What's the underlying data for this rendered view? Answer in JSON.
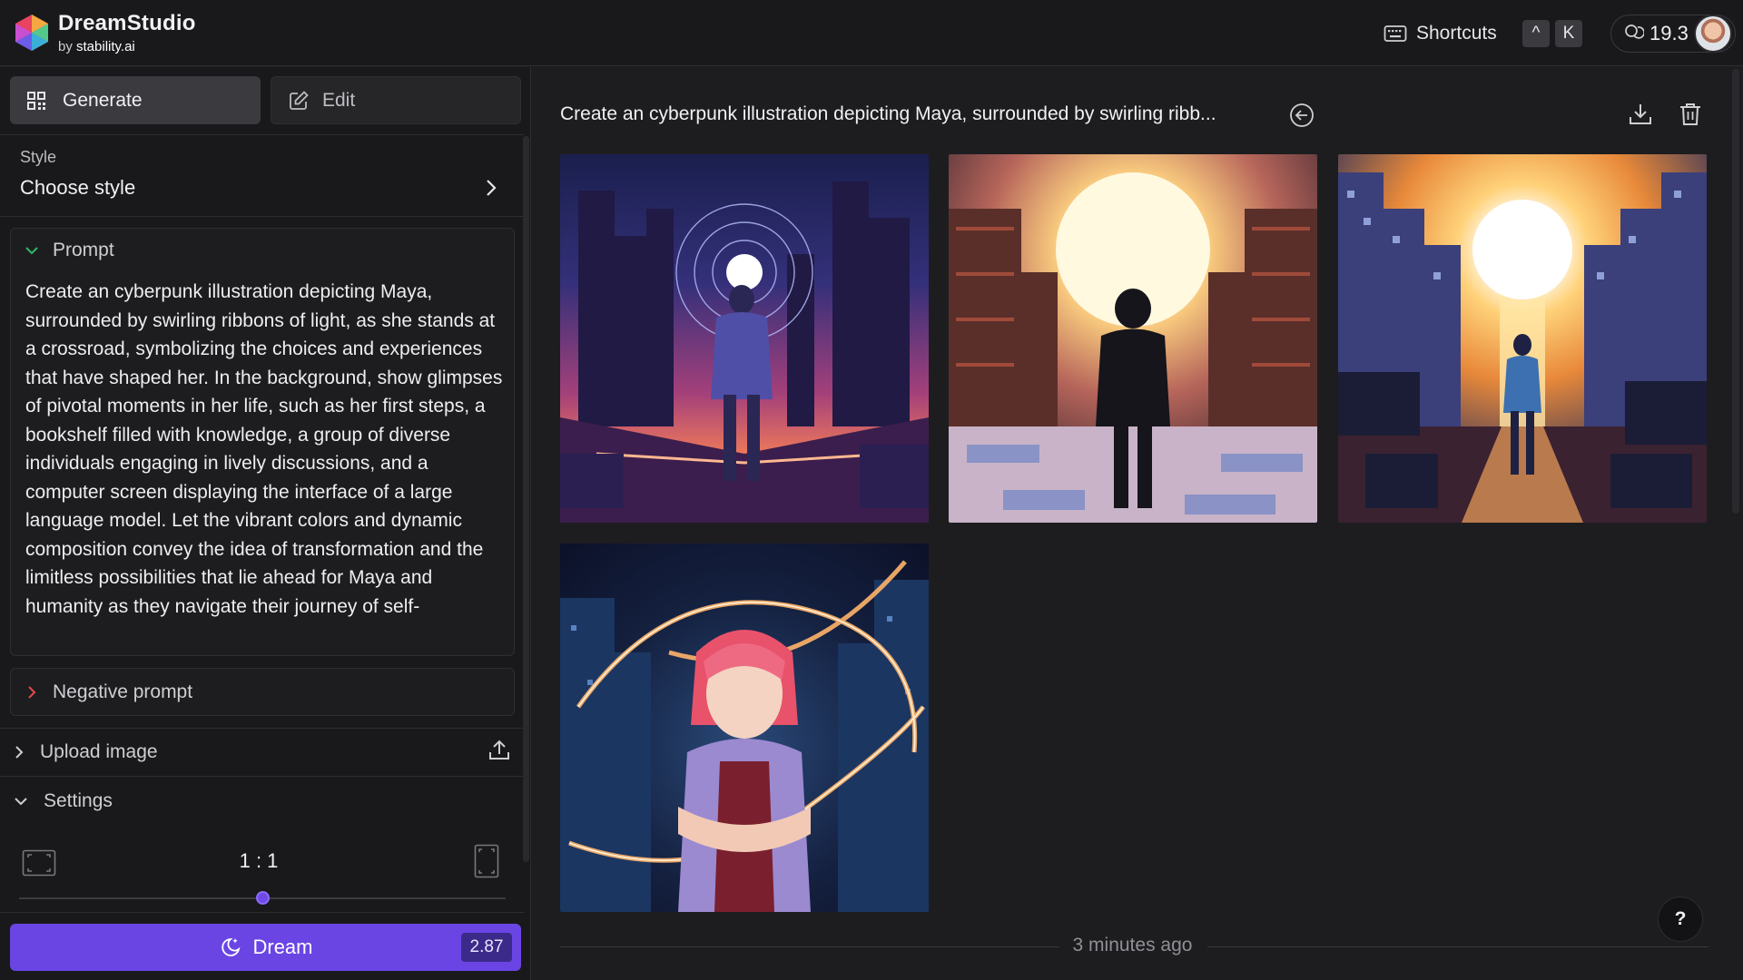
{
  "app": {
    "name": "DreamStudio",
    "byline_prefix": "by",
    "byline_brand": "stability.ai"
  },
  "header": {
    "shortcuts_label": "Shortcuts",
    "key_1": "^",
    "key_2": "K",
    "credits": "19.3"
  },
  "sidebar": {
    "tabs": [
      {
        "label": "Generate",
        "active": true
      },
      {
        "label": "Edit",
        "active": false
      }
    ],
    "style": {
      "label": "Style",
      "value": "Choose style"
    },
    "prompt": {
      "label": "Prompt",
      "text": "Create an cyberpunk illustration depicting Maya, surrounded by swirling ribbons of light, as she stands at a crossroad, symbolizing the choices and experiences that have shaped her. In the background, show glimpses of pivotal moments in her life, such as her first steps, a bookshelf filled with knowledge, a group of diverse individuals engaging in lively discussions, and a computer screen displaying the interface of a large language model. Let the vibrant colors and dynamic composition convey the idea of transformation and the limitless possibilities that lie ahead for Maya and humanity as they navigate their journey of self-"
    },
    "negative_prompt": {
      "label": "Negative prompt"
    },
    "upload_image": {
      "label": "Upload image"
    },
    "settings": {
      "label": "Settings",
      "aspect_ratio": "1 : 1",
      "aspect_slider_position": 0.5
    },
    "dream_button": {
      "label": "Dream",
      "cost": "2.87"
    }
  },
  "main": {
    "generation_title": "Create an cyberpunk illustration depicting Maya, surrounded by swirling ribb...",
    "images": [
      {
        "icon": "image-thumbnail",
        "subject": "silhouette facing swirling light portal in neon city"
      },
      {
        "icon": "image-thumbnail",
        "subject": "silhouette between bookshelves facing bright sun"
      },
      {
        "icon": "image-thumbnail",
        "subject": "figure facing bright sun between city buildings"
      },
      {
        "icon": "image-thumbnail",
        "subject": "girl with crossed arms amid light ribbons"
      }
    ],
    "timestamp": "3 minutes ago",
    "help_label": "?"
  },
  "colors": {
    "accent": "#6a45e4",
    "background": "#1d1d1f",
    "panel": "#19191b"
  }
}
